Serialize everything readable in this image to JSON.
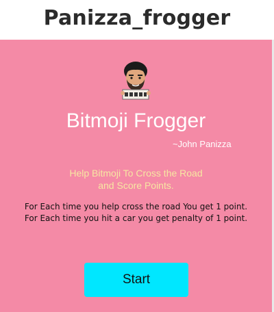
{
  "page": {
    "title": "Panizza_frogger"
  },
  "game": {
    "title": "Bitmoji Frogger",
    "author": "~John Panizza",
    "tagline_line1": "Help Bitmoji To Cross the Road",
    "tagline_line2": "and Score Points.",
    "rule_line1": "For Each time you help cross the road You get 1 point.",
    "rule_line2": "For Each time you hit a car you get penalty of 1 point.",
    "start_label": "Start",
    "avatar_icon": "bitmoji-avatar-icon"
  },
  "colors": {
    "panel_background": "#f48aa6",
    "tagline": "#f7e7a2",
    "start_button": "#00e7ff",
    "title_text": "#ffffff"
  }
}
